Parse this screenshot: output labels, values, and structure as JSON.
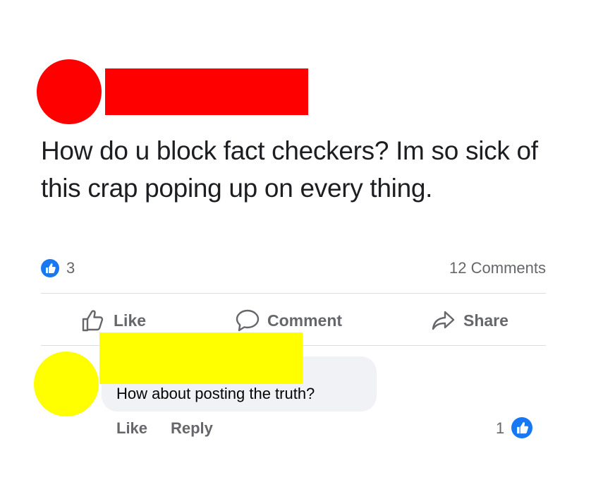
{
  "post": {
    "text": "How do u block fact checkers? Im so sick of this crap poping up on every thing.",
    "reaction_count": "3",
    "comments_label": "12 Comments"
  },
  "actions": {
    "like": "Like",
    "comment": "Comment",
    "share": "Share"
  },
  "comment": {
    "text": "How about posting the truth?",
    "like_label": "Like",
    "reply_label": "Reply",
    "reaction_count": "1"
  },
  "colors": {
    "facebook_blue": "#1877f2",
    "post_author_redaction": "#ff0000",
    "commenter_redaction": "#ffff00",
    "secondary_text": "#65676b"
  }
}
